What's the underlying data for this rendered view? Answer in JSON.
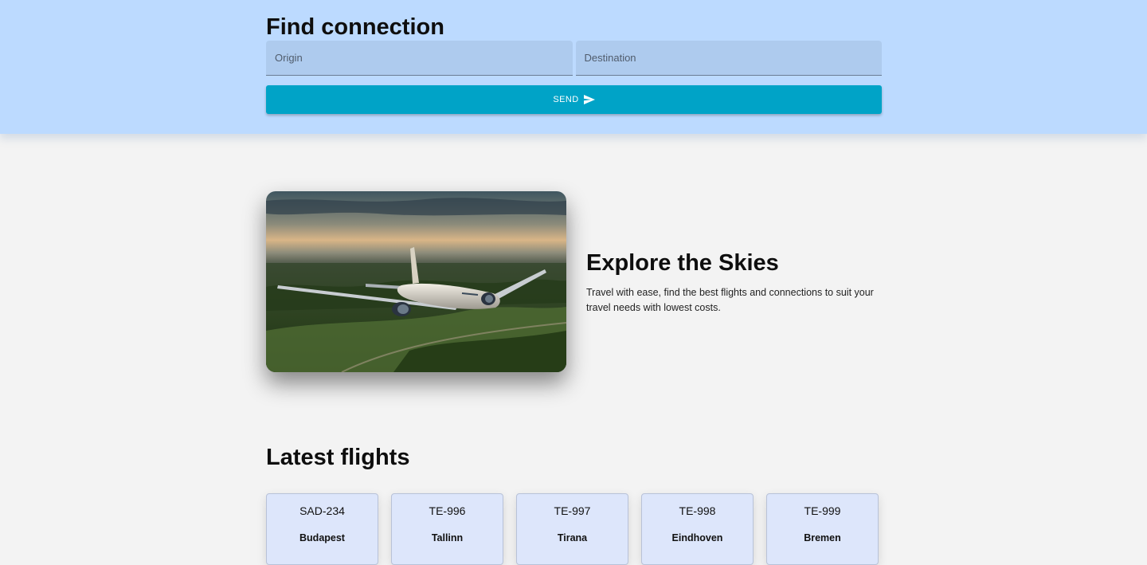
{
  "search": {
    "title": "Find connection",
    "origin_placeholder": "Origin",
    "origin_value": "",
    "destination_placeholder": "Destination",
    "destination_value": "",
    "send_label": "SEND",
    "send_icon": "send-icon"
  },
  "hero": {
    "title": "Explore the Skies",
    "description": "Travel with ease, find the best flights and connections to suit your travel needs with lowest costs.",
    "image": "airplane-over-forest-image"
  },
  "latest": {
    "title": "Latest flights",
    "flights": [
      {
        "code": "SAD-234",
        "city": "Budapest"
      },
      {
        "code": "TE-996",
        "city": "Tallinn"
      },
      {
        "code": "TE-997",
        "city": "Tirana"
      },
      {
        "code": "TE-998",
        "city": "Eindhoven"
      },
      {
        "code": "TE-999",
        "city": "Bremen"
      }
    ]
  },
  "colors": {
    "header_bg": "#bcdaff",
    "field_bg": "#aecbee",
    "send_button": "#00a3c7",
    "page_bg": "#f3f3f3",
    "card_bg": "#dde6fb"
  }
}
